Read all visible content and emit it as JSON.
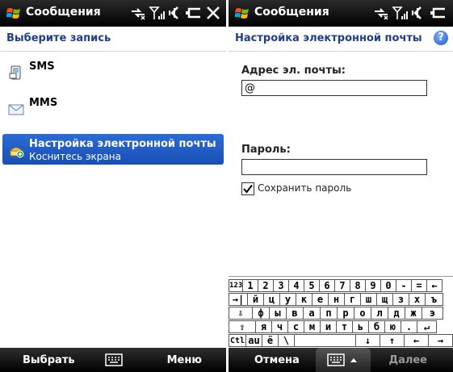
{
  "left": {
    "title": "Сообщения",
    "header": "Выберите запись",
    "items": [
      {
        "title": "SMS",
        "subtitle": ""
      },
      {
        "title": "MMS",
        "subtitle": ""
      },
      {
        "title": "Настройка электронной почты",
        "subtitle": "Коснитесь экрана"
      }
    ],
    "softkeys": {
      "left": "Выбрать",
      "right": "Меню"
    }
  },
  "right": {
    "title": "Сообщения",
    "header": "Настройка электронной почты",
    "help": "?",
    "email_label": "Адрес эл. почты:",
    "email_value": "@",
    "password_label": "Пароль:",
    "password_value": "",
    "save_password_label": "Сохранить пароль",
    "save_password_checked": true,
    "keyboard": {
      "rows": [
        [
          "123",
          "1",
          "2",
          "3",
          "4",
          "5",
          "6",
          "7",
          "8",
          "9",
          "0",
          "-",
          "=",
          "←"
        ],
        [
          "→|",
          "й",
          "ц",
          "у",
          "к",
          "е",
          "н",
          "г",
          "ш",
          "щ",
          "з",
          "х",
          "ъ"
        ],
        [
          "⇩",
          "ф",
          "ы",
          "в",
          "а",
          "п",
          "р",
          "о",
          "л",
          "д",
          "ж",
          "э"
        ],
        [
          "⇧",
          "я",
          "ч",
          "с",
          "м",
          "и",
          "т",
          "ь",
          "б",
          "ю",
          ".",
          "↵"
        ],
        [
          "Ctl",
          "au",
          "ё",
          "\\",
          "",
          "↓",
          "↑",
          "←",
          "→"
        ]
      ]
    },
    "softkeys": {
      "left": "Отмена",
      "right": "Далее"
    }
  },
  "colors": {
    "accent": "#1f3f8c",
    "selection": "#2c6bd6"
  }
}
